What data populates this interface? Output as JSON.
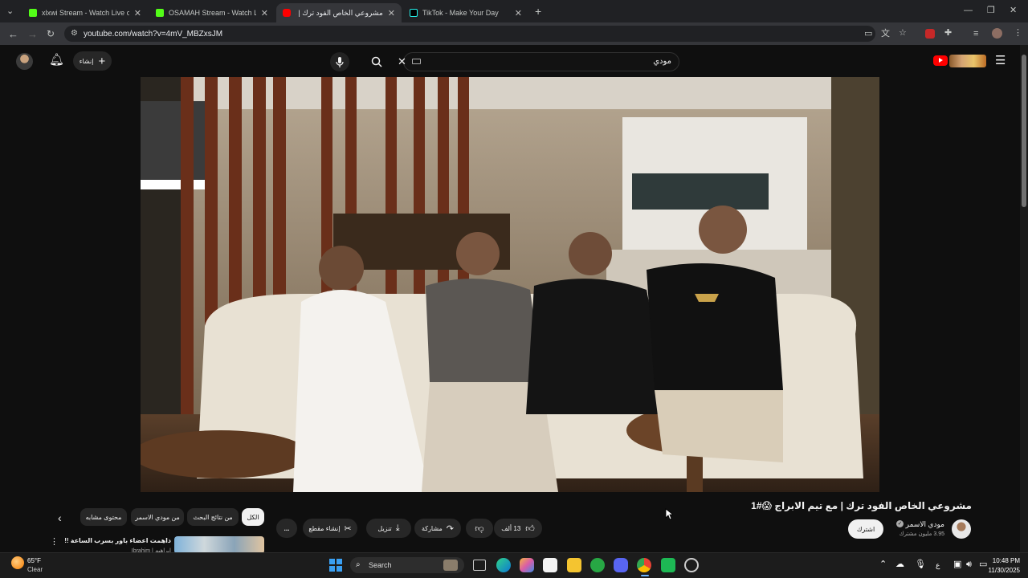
{
  "tabs": [
    {
      "title": "xlxwi Stream - Watch Live on K",
      "icon": "kick-logo-icon",
      "color": "#53fc18"
    },
    {
      "title": "OSAMAH Stream - Watch Live",
      "icon": "kick-logo-icon",
      "color": "#53fc18"
    },
    {
      "title": "مشروعي الخاص الفود ترك | مع ت",
      "icon": "youtube-logo-icon",
      "color": "#ff0000"
    },
    {
      "title": "TikTok - Make Your Day",
      "icon": "tiktok-logo-icon",
      "color": "#ffffff"
    }
  ],
  "new_tab": "+",
  "address": {
    "url": "youtube.com/watch?v=4mV_MBZxsJM"
  },
  "yt": {
    "create_label": "إنشاء",
    "search_value": "مودي",
    "brand_color": "#ff0000"
  },
  "video": {
    "title": "مشروعي الخاص الفود ترك | مع تيم الابراج 😱#1",
    "channel_name": "مودي الاسمر",
    "subscribers": "3.95 مليون مشترك",
    "subscribe_label": "اشترك",
    "likes": "13 ألف",
    "share_label": "مشاركة",
    "download_label": "تنزيل",
    "clip_label": "إنشاء مقطع",
    "more_label": "..."
  },
  "filters": [
    "الكل",
    "من نتائج البحث",
    "من مودي الاسمر",
    "محتوى مشابه"
  ],
  "related": [
    {
      "title": "داهمت اعضاء باور بسرب الساعة !!",
      "channel": "Ibrahim | ابراهيم"
    }
  ],
  "taskbar": {
    "weather_temp": "65°F",
    "weather_text": "Clear",
    "search_placeholder": "Search",
    "time": "10:48 PM",
    "date": "11/30/2025",
    "lang": "ع"
  }
}
